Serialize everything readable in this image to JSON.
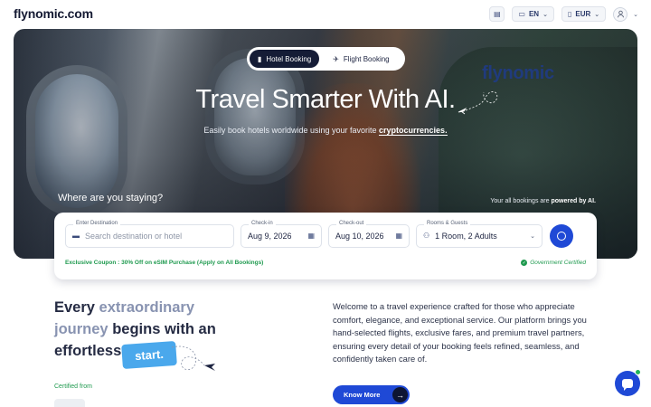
{
  "brand": {
    "logo": "flynomic.com",
    "hero_watermark": "flynomic"
  },
  "topbar": {
    "doc_icon": "document-icon",
    "language": {
      "code": "EN",
      "icon": "flag-icon"
    },
    "currency": {
      "code": "EUR",
      "icon": "wallet-icon"
    },
    "user_icon": "user-icon"
  },
  "hero": {
    "tabs": [
      {
        "label": "Hotel Booking",
        "icon": "hotel-icon",
        "active": true
      },
      {
        "label": "Flight Booking",
        "icon": "plane-icon",
        "active": false
      }
    ],
    "title": "Travel Smarter With AI.",
    "subtitle_pre": "Easily book hotels worldwide using your favorite ",
    "subtitle_highlight": "cryptocurrencies.",
    "stay_question": "Where are you staying?",
    "powered_pre": "Your all bookings are ",
    "powered_highlight": "powered by AI."
  },
  "search": {
    "destination": {
      "label": "Enter Destination",
      "placeholder": "Search destination or hotel"
    },
    "checkin": {
      "label": "Check-in",
      "value": "Aug 9, 2026"
    },
    "checkout": {
      "label": "Check-out",
      "value": "Aug 10, 2026"
    },
    "guests": {
      "label": "Rooms & Guests",
      "value": "1 Room, 2 Adults"
    },
    "coupon": "Exclusive Coupon : 30% Off on eSIM Purchase (Apply on All Bookings)",
    "certified": "Government Certified"
  },
  "about": {
    "headline_1a": "Every ",
    "headline_1b": "extraordinary",
    "headline_2a": "journey",
    "headline_2b": " begins with an",
    "headline_3": "effortless",
    "badge": "start.",
    "certified_from": "Certified from",
    "intro": "Welcome to a travel experience crafted for those who appreciate comfort, elegance, and exceptional service. Our platform brings you hand-selected flights, exclusive fares, and premium travel partners, ensuring every detail of your booking feels refined, seamless, and confidently taken care of.",
    "cta": "Know More"
  },
  "colors": {
    "primary": "#1f49d6",
    "dark": "#151c36",
    "success": "#1f9a4f",
    "badge": "#4aa8ec"
  }
}
